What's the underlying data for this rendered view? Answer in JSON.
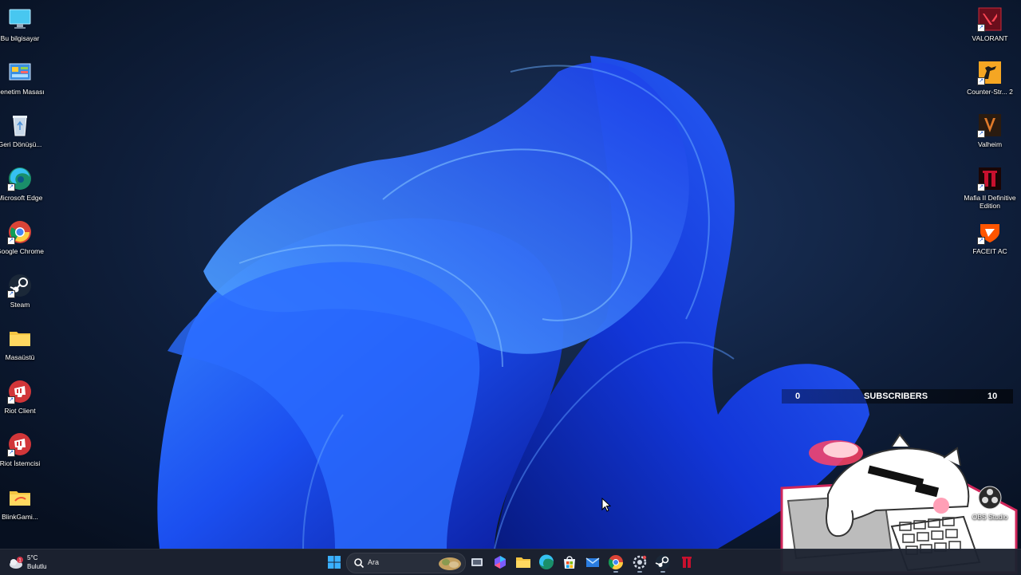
{
  "desktop": {
    "left_icons": [
      {
        "label": "Bu bilgisayar",
        "icon": "monitor-icon",
        "shortcut": false
      },
      {
        "label": "Denetim Masası",
        "icon": "control-panel-icon",
        "shortcut": false
      },
      {
        "label": "Geri Dönüşü...",
        "icon": "recycle-bin-icon",
        "shortcut": false
      },
      {
        "label": "Microsoft Edge",
        "icon": "edge-icon",
        "shortcut": true
      },
      {
        "label": "Google Chrome",
        "icon": "chrome-icon",
        "shortcut": true
      },
      {
        "label": "Steam",
        "icon": "steam-icon",
        "shortcut": true
      },
      {
        "label": "Masaüstü",
        "icon": "folder-icon",
        "shortcut": false
      },
      {
        "label": "Riot Client",
        "icon": "riot-client-icon",
        "shortcut": true
      },
      {
        "label": "Riot İstemcisi",
        "icon": "riot-client-icon",
        "shortcut": true
      },
      {
        "label": "BlinkGami...",
        "icon": "folder-icon",
        "shortcut": false
      }
    ],
    "right_icons": [
      {
        "label": "VALORANT",
        "icon": "valorant-icon",
        "shortcut": true
      },
      {
        "label": "Counter-Str... 2",
        "icon": "counter-strike-icon",
        "shortcut": true
      },
      {
        "label": "Valheim",
        "icon": "valheim-icon",
        "shortcut": true
      },
      {
        "label": "Mafia II Definitive Edition",
        "icon": "mafia-icon",
        "shortcut": true
      },
      {
        "label": "FACEIT AC",
        "icon": "faceit-icon",
        "shortcut": true
      },
      {
        "label": "OBS Studio",
        "icon": "obs-icon",
        "shortcut": false
      }
    ]
  },
  "subscriber_bar": {
    "start": "0",
    "label": "SUBSCRIBERS",
    "goal": "10"
  },
  "taskbar": {
    "weather": {
      "temp": "5°C",
      "condition": "Bulutlu"
    },
    "search": {
      "placeholder": "Ara"
    },
    "pinned_apps": [
      "start-icon",
      "task-view-icon",
      "m365-icon",
      "file-explorer-icon",
      "edge-icon",
      "store-icon",
      "mail-icon",
      "chrome-icon",
      "settings-icon",
      "steam-icon",
      "mafia-icon"
    ]
  },
  "colors": {
    "taskbar": "#1c2230",
    "wallpaper_bloom": "#1a4ff0",
    "background": "#0a1628"
  }
}
